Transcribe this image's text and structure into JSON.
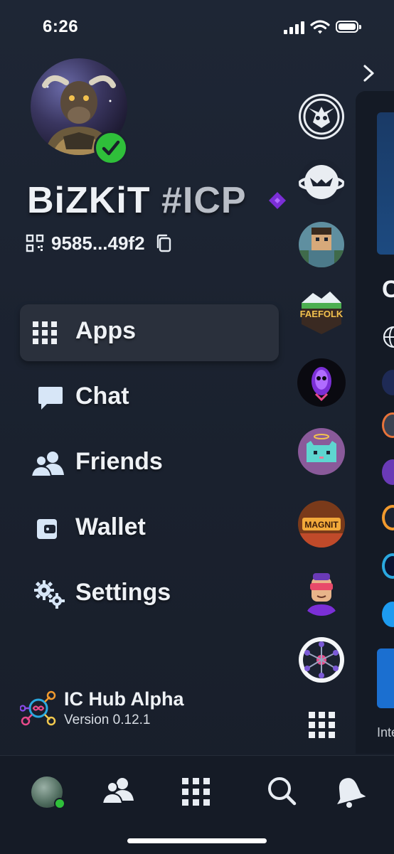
{
  "status_bar": {
    "time": "6:26"
  },
  "profile": {
    "name": "BiZKiT",
    "tag": "#ICP",
    "principal": "9585...49f2",
    "avatar_icon": "bull-warrior-avatar",
    "verified_icon": "check-icon",
    "badge_icon": "purple-diamond-icon"
  },
  "menu": {
    "items": [
      {
        "label": "Apps",
        "icon": "grid-icon",
        "active": true
      },
      {
        "label": "Chat",
        "icon": "chat-bubble-icon",
        "active": false
      },
      {
        "label": "Friends",
        "icon": "friends-icon",
        "active": false
      },
      {
        "label": "Wallet",
        "icon": "wallet-icon",
        "active": false
      },
      {
        "label": "Settings",
        "icon": "gears-icon",
        "active": false
      }
    ]
  },
  "footer": {
    "app_name": "IC Hub Alpha",
    "version": "Version 0.12.1"
  },
  "app_rail": {
    "apps": [
      {
        "name": "skull-horns-app-icon"
      },
      {
        "name": "planet-mask-app-icon"
      },
      {
        "name": "pixel-character-app-icon"
      },
      {
        "name": "faefolk-app-icon",
        "label": "FAEFOLK"
      },
      {
        "name": "purple-skull-app-icon"
      },
      {
        "name": "pixel-cat-app-icon"
      },
      {
        "name": "magnit-app-icon",
        "label": "MAGNIT"
      },
      {
        "name": "visor-character-app-icon"
      },
      {
        "name": "network-node-app-icon"
      }
    ]
  },
  "side_panel": {
    "heading_initial": "C",
    "footer_text": "Inte"
  },
  "bottom_nav": [
    "profile-tab",
    "friends-tab",
    "apps-tab",
    "search-tab",
    "notifications-tab"
  ],
  "colors": {
    "background": "#1b2230",
    "online": "#2fbf3a",
    "accent_purple": "#7b2fd6"
  }
}
